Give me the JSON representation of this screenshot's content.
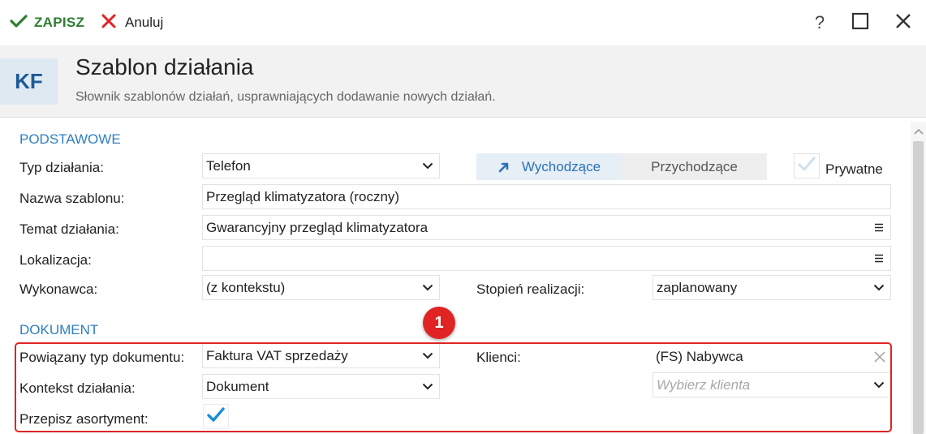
{
  "toolbar": {
    "save_label": "ZAPISZ",
    "cancel_label": "Anuluj",
    "help_label": "?"
  },
  "header": {
    "badge": "KF",
    "title": "Szablon działania",
    "subtitle": "Słownik szablonów działań, usprawniających dodawanie nowych działań."
  },
  "basic": {
    "section": "PODSTAWOWE",
    "type_label": "Typ działania:",
    "type_value": "Telefon",
    "direction_out": "Wychodzące",
    "direction_in": "Przychodzące",
    "private_label": "Prywatne",
    "name_label": "Nazwa szablonu:",
    "name_value": "Przegląd klimatyzatora (roczny)",
    "topic_label": "Temat działania:",
    "topic_value": "Gwarancyjny przegląd klimatyzatora",
    "location_label": "Lokalizacja:",
    "location_value": "",
    "executor_label": "Wykonawca:",
    "executor_value": "(z kontekstu)",
    "progress_label": "Stopień realizacji:",
    "progress_value": "zaplanowany"
  },
  "document": {
    "section": "DOKUMENT",
    "doc_type_label": "Powiązany typ dokumentu:",
    "doc_type_value": "Faktura VAT sprzedaży",
    "clients_label": "Klienci:",
    "client_value": "(FS) Nabywca",
    "client_placeholder": "Wybierz klienta",
    "context_label": "Kontekst działania:",
    "context_value": "Dokument",
    "copy_items_label": "Przepisz asortyment:"
  },
  "annotation": {
    "marker": "1",
    "color": "#e02424"
  },
  "colors": {
    "accent": "#2f7fc1",
    "save_green": "#2e7d32",
    "check_blue": "#1a8fd8"
  }
}
